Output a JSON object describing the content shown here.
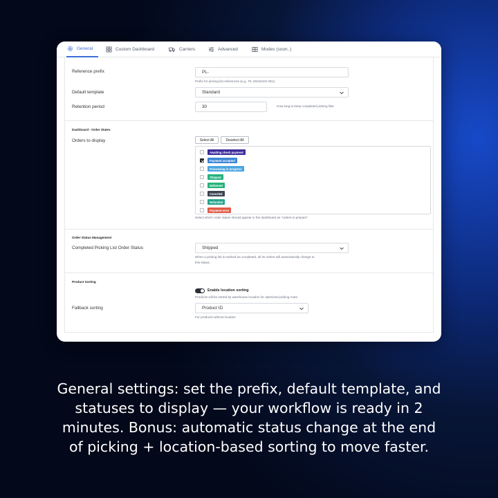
{
  "tabs": [
    {
      "label": "General",
      "icon": "gear-icon",
      "active": true
    },
    {
      "label": "Custom Dashboard",
      "icon": "dashboard-icon",
      "active": false
    },
    {
      "label": "Carriers",
      "icon": "truck-icon",
      "active": false
    },
    {
      "label": "Advanced",
      "icon": "sliders-icon",
      "active": false
    },
    {
      "label": "Modes (soon..)",
      "icon": "grid-icon",
      "active": false
    }
  ],
  "general": {
    "reference_prefix_label": "Reference prefix",
    "reference_prefix_value": "PL-",
    "reference_prefix_help": "Prefix for picking list references (e.g., PL-20240101-001)",
    "default_template_label": "Default template",
    "default_template_value": "Standard",
    "retention_label": "Retention period",
    "retention_value": "30",
    "retention_help": "How long to keep completed picking lists"
  },
  "dashboard": {
    "section_title": "Dashboard - Order States",
    "orders_label": "Orders to display",
    "select_all": "Select All",
    "deselect_all": "Deselect All",
    "states": [
      {
        "label": "Awaiting check payment",
        "color": "#3b2a9a",
        "checked": false
      },
      {
        "label": "Payment accepted",
        "color": "#3b86d6",
        "checked": true
      },
      {
        "label": "Processing in progress",
        "color": "#4aa5e0",
        "checked": false
      },
      {
        "label": "Shipped",
        "color": "#22b07d",
        "checked": false
      },
      {
        "label": "Delivered",
        "color": "#26b37a",
        "checked": false
      },
      {
        "label": "Canceled",
        "color": "#3b4450",
        "checked": false
      },
      {
        "label": "Refunded",
        "color": "#22a58b",
        "checked": false
      },
      {
        "label": "Payment error",
        "color": "#e25b45",
        "checked": false
      }
    ],
    "help": "Select which order states should appear in the dashboard as \"orders to prepare\"."
  },
  "order_status": {
    "section_title": "Order Status Management",
    "label": "Completed Picking List Order Status",
    "value": "Shipped",
    "help_line1": "When a picking list is marked as completed, all its orders will automatically change to",
    "help_line2": "this status."
  },
  "product_sorting": {
    "section_title": "Product Sorting",
    "toggle_label": "Enable location sorting",
    "toggle_on": true,
    "toggle_help": "Products will be sorted by warehouse location for optimized picking route.",
    "fallback_label": "Fallback sorting",
    "fallback_value": "Product ID",
    "fallback_help": "For products without location"
  },
  "caption": {
    "line1": "General settings: set the prefix, default template, and",
    "line2": "statuses to display — your workflow is ready in 2",
    "line3": "minutes. Bonus: automatic status change at the end",
    "line4": "of picking + location-based sorting to move faster."
  }
}
